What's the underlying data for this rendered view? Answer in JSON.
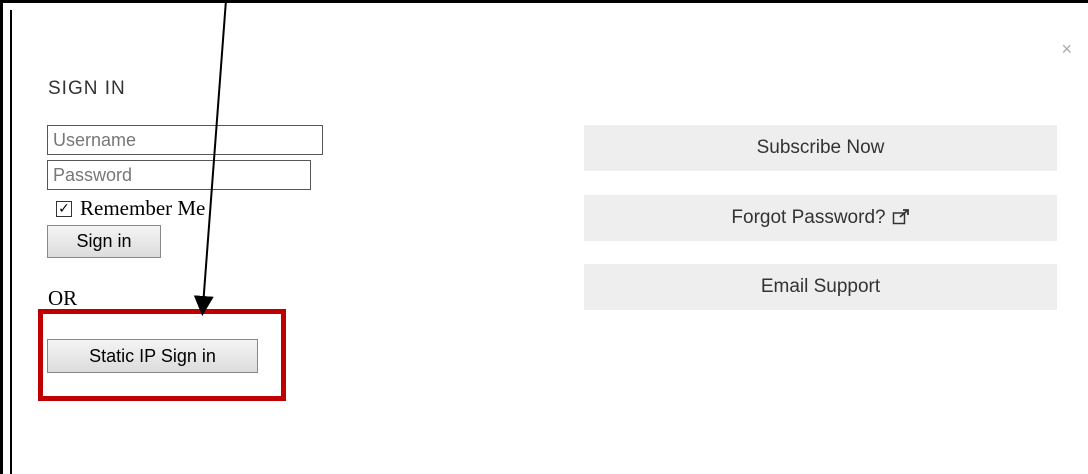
{
  "dialog": {
    "title": "SIGN IN",
    "close_symbol": "×"
  },
  "login": {
    "username_placeholder": "Username",
    "password_placeholder": "Password",
    "remember_label": "Remember Me",
    "remember_checked": true,
    "signin_label": "Sign in",
    "or_label": "OR",
    "static_ip_label": "Static IP Sign in"
  },
  "actions": {
    "subscribe_label": "Subscribe Now",
    "forgot_label": "Forgot Password?",
    "email_label": "Email Support"
  },
  "colors": {
    "highlight": "#c00000",
    "button_bg": "#eeeeee"
  },
  "icons": {
    "close": "close-icon",
    "external": "external-link-icon",
    "check": "checkmark-icon"
  }
}
